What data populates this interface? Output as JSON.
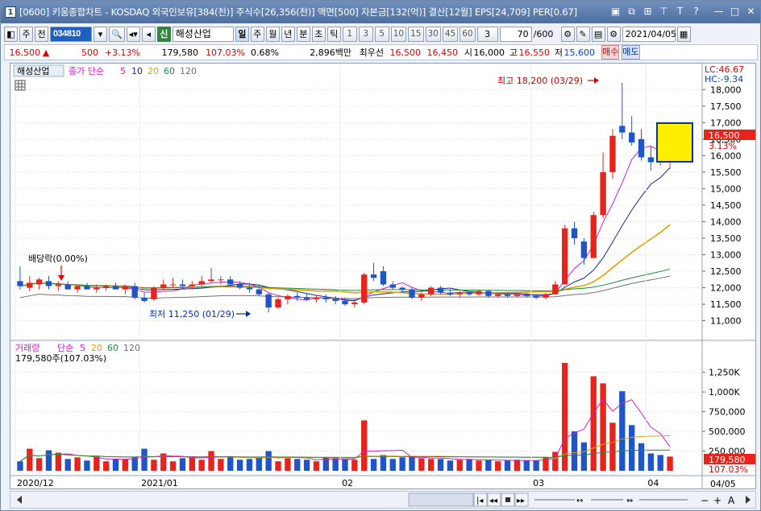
{
  "window": {
    "number": "1",
    "title": "[0600] 키움종합차트 - KOSDAQ 외국인보유[384(천)] 주식수[26,356(천)] 액면[500] 자본금[132(억)] 결산[12월] EPS[24,709] PER[0.67]"
  },
  "toolbar": {
    "period": "주",
    "prev": "전",
    "code": "034810",
    "shin": "신",
    "name": "해성산업",
    "periods": [
      "일",
      "주",
      "월",
      "년",
      "분",
      "초",
      "틱"
    ],
    "active_period": "일",
    "numbers": [
      "1",
      "3",
      "5",
      "10",
      "15",
      "30",
      "45",
      "60"
    ],
    "count_select": "3",
    "bars": "70",
    "bars_total": "/600",
    "date": "2021/04/05"
  },
  "quote": {
    "price": "16,500",
    "arrow": "▲",
    "change": "500",
    "change_pct": "+3.13%",
    "volume": "179,580",
    "vol_pct": "107.03%",
    "turnover": "0.68%",
    "amount": "2,896백만",
    "best_label": "최우선",
    "best_ask": "16,500",
    "best_bid": "16,450",
    "open_label": "시",
    "open": "16,000",
    "high_label": "고",
    "high": "16,550",
    "low_label": "저",
    "low": "15,600",
    "buy": "매수",
    "sell": "매도"
  },
  "price_panel": {
    "name_tag": "해성산업",
    "indicator": "종가 단순",
    "ma": [
      "5",
      "10",
      "20",
      "60",
      "120"
    ],
    "lc": "LC:46.67",
    "hc": "HC:-9.34",
    "current_price": "16,500",
    "current_pct": "3.13%",
    "high_annotation": "최고 18,200 (03/29)",
    "low_annotation": "최저 11,250 (01/29)",
    "dividend": "배당락(0.00%)",
    "y_ticks": [
      "18,000",
      "17,500",
      "17,000",
      "16,500",
      "16,000",
      "15,500",
      "15,000",
      "14,500",
      "14,000",
      "13,500",
      "13,000",
      "12,500",
      "12,000",
      "11,500",
      "11,000"
    ],
    "y_top_partial": "18,000"
  },
  "volume_panel": {
    "title": "거래량",
    "indicator": "단순",
    "ma": [
      "5",
      "20",
      "60",
      "120"
    ],
    "current": "179,580주(107.03%)",
    "y_ticks": [
      "1,250K",
      "1,000K",
      "750,000",
      "500,000",
      "250,000"
    ],
    "current_value": "179,580",
    "current_pct": "107.03%"
  },
  "x_axis": {
    "labels": [
      "2020/12",
      "2021/01",
      "02",
      "03",
      "04"
    ],
    "right_date": "04/05"
  },
  "colors": {
    "up": "#e8231b",
    "down": "#1f55c8",
    "ma5": "#d020c0",
    "ma10": "#1a2a8a",
    "ma20": "#e0a000",
    "ma60": "#208a40",
    "ma120": "#707070"
  },
  "chart_data": {
    "type": "candlestick",
    "candles": [
      {
        "o": 12200,
        "h": 12650,
        "l": 11950,
        "c": 12050
      },
      {
        "o": 12000,
        "h": 12350,
        "l": 11900,
        "c": 12150
      },
      {
        "o": 12100,
        "h": 12300,
        "l": 11950,
        "c": 12250
      },
      {
        "o": 12200,
        "h": 12350,
        "l": 11950,
        "c": 12050
      },
      {
        "o": 12050,
        "h": 12200,
        "l": 11900,
        "c": 12100
      },
      {
        "o": 12100,
        "h": 12200,
        "l": 11950,
        "c": 11950
      },
      {
        "o": 11950,
        "h": 12100,
        "l": 11850,
        "c": 12050
      },
      {
        "o": 12050,
        "h": 12150,
        "l": 11950,
        "c": 11950
      },
      {
        "o": 11950,
        "h": 12100,
        "l": 11850,
        "c": 12000
      },
      {
        "o": 12000,
        "h": 12100,
        "l": 11900,
        "c": 12050
      },
      {
        "o": 12050,
        "h": 12150,
        "l": 11950,
        "c": 11950
      },
      {
        "o": 11950,
        "h": 12100,
        "l": 11800,
        "c": 12050
      },
      {
        "o": 12050,
        "h": 12150,
        "l": 11650,
        "c": 11700
      },
      {
        "o": 11700,
        "h": 11850,
        "l": 11550,
        "c": 11600
      },
      {
        "o": 11650,
        "h": 12050,
        "l": 11600,
        "c": 12000
      },
      {
        "o": 12000,
        "h": 12250,
        "l": 11950,
        "c": 12100
      },
      {
        "o": 12100,
        "h": 12300,
        "l": 12000,
        "c": 12100
      },
      {
        "o": 12100,
        "h": 12250,
        "l": 11950,
        "c": 12050
      },
      {
        "o": 12050,
        "h": 12200,
        "l": 11950,
        "c": 12100
      },
      {
        "o": 12100,
        "h": 12350,
        "l": 12050,
        "c": 12200
      },
      {
        "o": 12200,
        "h": 12600,
        "l": 12150,
        "c": 12250
      },
      {
        "o": 12250,
        "h": 12350,
        "l": 12100,
        "c": 12250
      },
      {
        "o": 12250,
        "h": 12350,
        "l": 12100,
        "c": 12100
      },
      {
        "o": 12100,
        "h": 12200,
        "l": 11950,
        "c": 12000
      },
      {
        "o": 12000,
        "h": 12150,
        "l": 11850,
        "c": 11950
      },
      {
        "o": 11950,
        "h": 12100,
        "l": 11750,
        "c": 11800
      },
      {
        "o": 11800,
        "h": 11850,
        "l": 11250,
        "c": 11400
      },
      {
        "o": 11400,
        "h": 11700,
        "l": 11350,
        "c": 11650
      },
      {
        "o": 11650,
        "h": 11800,
        "l": 11500,
        "c": 11750
      },
      {
        "o": 11750,
        "h": 11850,
        "l": 11600,
        "c": 11700
      },
      {
        "o": 11700,
        "h": 11800,
        "l": 11600,
        "c": 11650
      },
      {
        "o": 11650,
        "h": 11750,
        "l": 11550,
        "c": 11700
      },
      {
        "o": 11700,
        "h": 11800,
        "l": 11550,
        "c": 11650
      },
      {
        "o": 11650,
        "h": 11750,
        "l": 11500,
        "c": 11600
      },
      {
        "o": 11600,
        "h": 11700,
        "l": 11450,
        "c": 11500
      },
      {
        "o": 11500,
        "h": 11650,
        "l": 11400,
        "c": 11550
      },
      {
        "o": 11550,
        "h": 12450,
        "l": 11500,
        "c": 12400
      },
      {
        "o": 12400,
        "h": 12750,
        "l": 12200,
        "c": 12300
      },
      {
        "o": 12500,
        "h": 12650,
        "l": 12050,
        "c": 12100
      },
      {
        "o": 12100,
        "h": 12200,
        "l": 11950,
        "c": 12000
      },
      {
        "o": 12000,
        "h": 12050,
        "l": 11850,
        "c": 11950
      },
      {
        "o": 11950,
        "h": 12000,
        "l": 11650,
        "c": 11700
      },
      {
        "o": 11700,
        "h": 11850,
        "l": 11600,
        "c": 11800
      },
      {
        "o": 11800,
        "h": 12050,
        "l": 11750,
        "c": 12000
      },
      {
        "o": 12000,
        "h": 12050,
        "l": 11800,
        "c": 11850
      },
      {
        "o": 11850,
        "h": 11950,
        "l": 11750,
        "c": 11800
      },
      {
        "o": 11800,
        "h": 11900,
        "l": 11700,
        "c": 11850
      },
      {
        "o": 11850,
        "h": 11900,
        "l": 11750,
        "c": 11800
      },
      {
        "o": 11800,
        "h": 11950,
        "l": 11750,
        "c": 11900
      },
      {
        "o": 11900,
        "h": 11950,
        "l": 11700,
        "c": 11750
      },
      {
        "o": 11750,
        "h": 11850,
        "l": 11700,
        "c": 11800
      },
      {
        "o": 11800,
        "h": 11850,
        "l": 11700,
        "c": 11750
      },
      {
        "o": 11750,
        "h": 11850,
        "l": 11700,
        "c": 11800
      },
      {
        "o": 11800,
        "h": 11850,
        "l": 11700,
        "c": 11750
      },
      {
        "o": 11750,
        "h": 11800,
        "l": 11650,
        "c": 11700
      },
      {
        "o": 11700,
        "h": 11850,
        "l": 11650,
        "c": 11800
      },
      {
        "o": 11800,
        "h": 12200,
        "l": 11800,
        "c": 12100
      },
      {
        "o": 12100,
        "h": 13900,
        "l": 12100,
        "c": 13800
      },
      {
        "o": 13800,
        "h": 14000,
        "l": 13300,
        "c": 13500
      },
      {
        "o": 13400,
        "h": 13500,
        "l": 12700,
        "c": 12900
      },
      {
        "o": 12900,
        "h": 14300,
        "l": 12900,
        "c": 14200
      },
      {
        "o": 14200,
        "h": 16100,
        "l": 14100,
        "c": 15500
      },
      {
        "o": 15500,
        "h": 16800,
        "l": 15300,
        "c": 16600
      },
      {
        "o": 16900,
        "h": 18200,
        "l": 16500,
        "c": 16700
      },
      {
        "o": 16700,
        "h": 17200,
        "l": 16300,
        "c": 16400
      },
      {
        "o": 16500,
        "h": 16800,
        "l": 15850,
        "c": 15950
      },
      {
        "o": 15950,
        "h": 16300,
        "l": 15550,
        "c": 15800
      },
      {
        "o": 16000,
        "h": 16700,
        "l": 15700,
        "c": 15800
      },
      {
        "o": 16000,
        "h": 16550,
        "l": 15600,
        "c": 16500
      }
    ],
    "volume": [
      120,
      280,
      160,
      260,
      230,
      150,
      170,
      130,
      180,
      120,
      150,
      150,
      170,
      280,
      140,
      220,
      120,
      160,
      180,
      140,
      250,
      150,
      180,
      140,
      150,
      160,
      250,
      120,
      160,
      150,
      140,
      120,
      170,
      160,
      150,
      140,
      640,
      150,
      200,
      150,
      170,
      180,
      160,
      150,
      150,
      130,
      140,
      150,
      130,
      140,
      120,
      130,
      140,
      130,
      130,
      170,
      240,
      1370,
      500,
      360,
      1200,
      1110,
      610,
      1010,
      580,
      350,
      220,
      200,
      180
    ]
  }
}
